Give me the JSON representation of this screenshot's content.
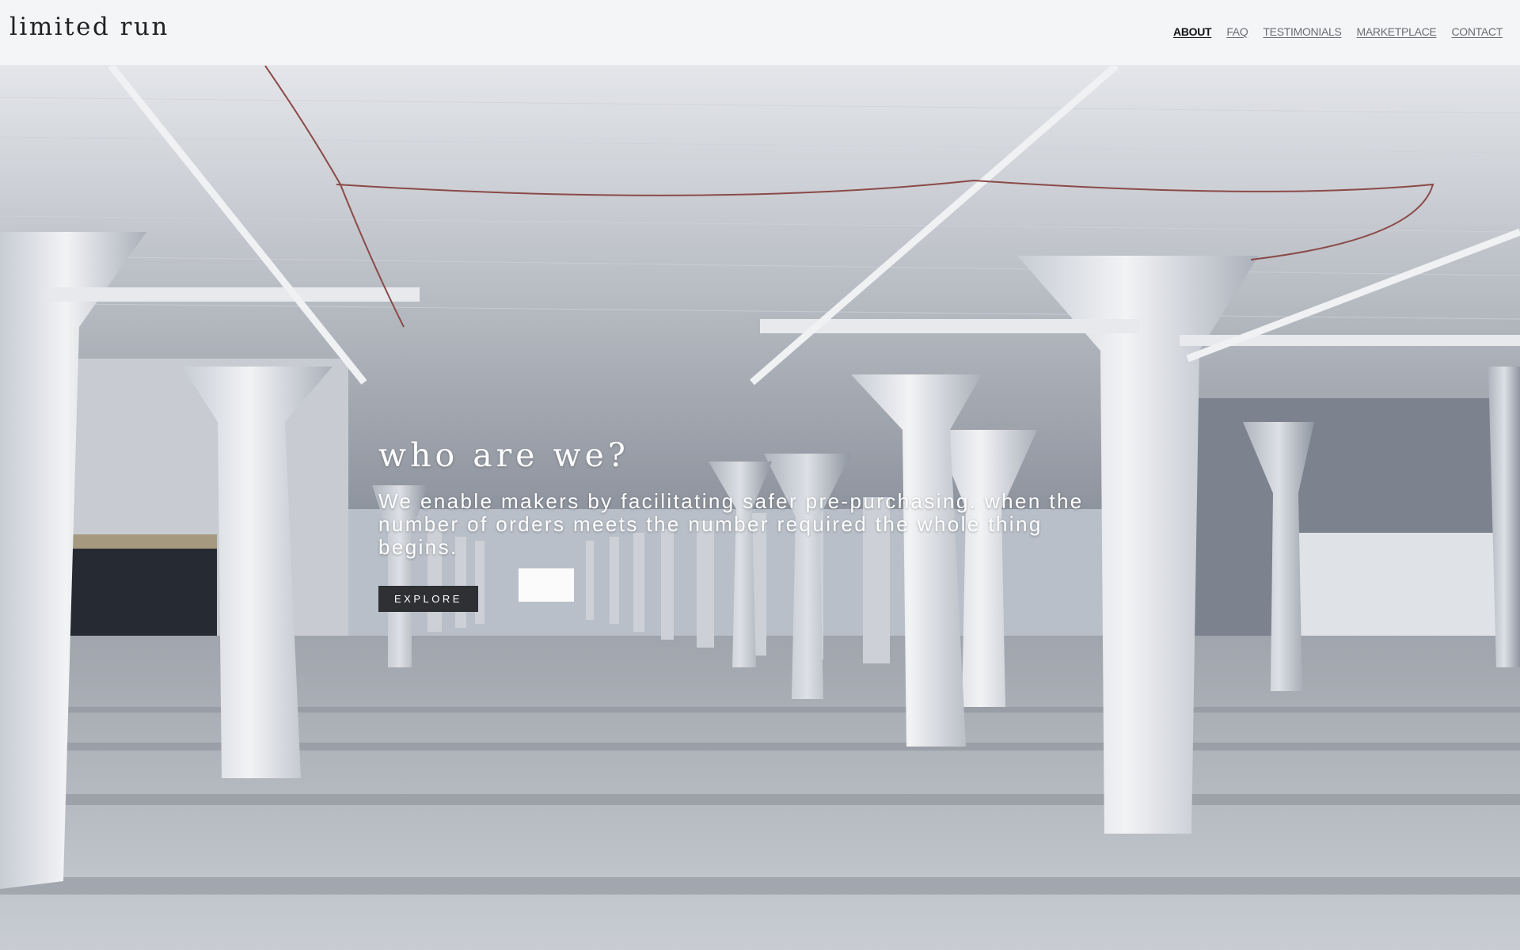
{
  "header": {
    "logo": "limited run",
    "nav": [
      {
        "label": "ABOUT",
        "active": true
      },
      {
        "label": "FAQ",
        "active": false
      },
      {
        "label": "TESTIMONIALS",
        "active": false
      },
      {
        "label": "MARKETPLACE",
        "active": false
      },
      {
        "label": "CONTACT",
        "active": false
      }
    ]
  },
  "hero": {
    "title": "who are we?",
    "description": "We enable makers by facilitating safer pre-purchasing. when the number of orders meets the number required the whole thing begins.",
    "button_label": "EXPLORE",
    "image_alt": "Empty white-columned warehouse interior"
  },
  "colors": {
    "header_bg": "#f4f5f7",
    "button_bg": "#2f3033",
    "text_light": "#ffffff"
  }
}
